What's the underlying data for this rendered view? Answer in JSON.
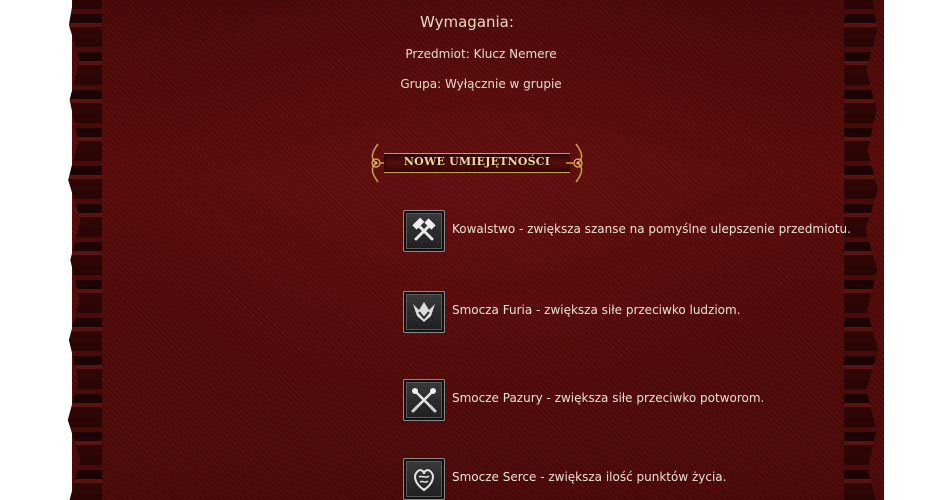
{
  "requirements": {
    "title": "Wymagania:",
    "item": "Przedmiot: Klucz Nemere",
    "group": "Grupa: Wyłącznie w grupie"
  },
  "section": {
    "title": "NOWE UMIEJĘTNOŚCI"
  },
  "skills": [
    {
      "icon": "hammer-crossed-icon",
      "text": "Kowalstwo - zwiększa szanse na pomyślne ulepszenie przedmiotu."
    },
    {
      "icon": "dragon-fury-icon",
      "text": "Smocza Furia - zwiększa siłe przeciwko ludziom."
    },
    {
      "icon": "dragon-claws-icon",
      "text": "Smocze Pazury - zwiększa siłe przeciwko potworom."
    },
    {
      "icon": "dragon-heart-icon",
      "text": "Smocze Serce - zwiększa ilość punktów życia."
    }
  ],
  "colors": {
    "background": "#520a0a",
    "text": "#ece2d2",
    "banner_accent": "#c9a24a"
  }
}
